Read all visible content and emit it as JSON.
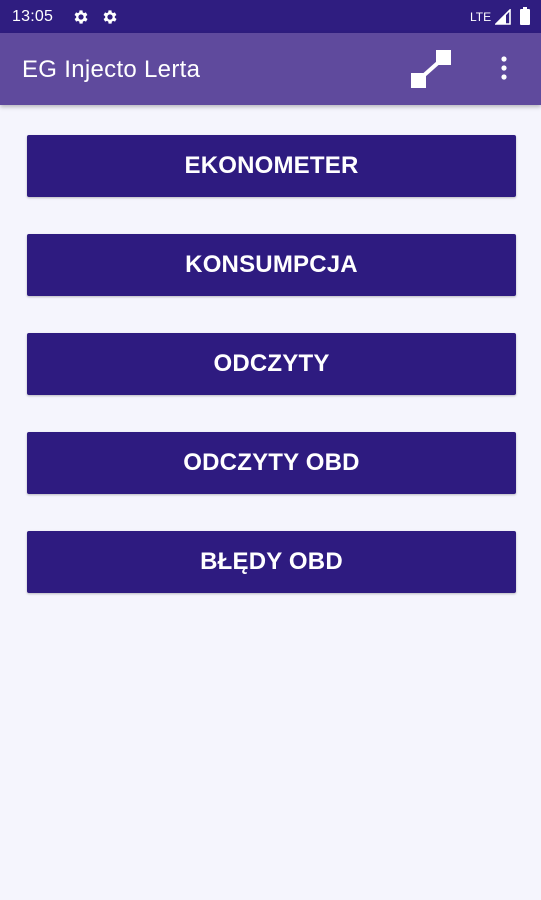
{
  "status_bar": {
    "time": "13:05",
    "network": "LTE",
    "icons": [
      "gear-icon",
      "gear-icon",
      "signal-icon",
      "battery-icon"
    ]
  },
  "app_bar": {
    "title": "EG Injecto Lerta",
    "actions": [
      "connect-icon",
      "overflow-menu-icon"
    ]
  },
  "menu": {
    "buttons": [
      {
        "label": "EKONOMETER"
      },
      {
        "label": "KONSUMPCJA"
      },
      {
        "label": "ODCZYTY"
      },
      {
        "label": "ODCZYTY OBD"
      },
      {
        "label": "BŁĘDY OBD"
      }
    ]
  },
  "colors": {
    "status_bar": "#2f1d80",
    "app_bar": "#5f4a9d",
    "button": "#2e1b80",
    "background": "#f5f5fd",
    "text_on_dark": "#ffffff"
  }
}
